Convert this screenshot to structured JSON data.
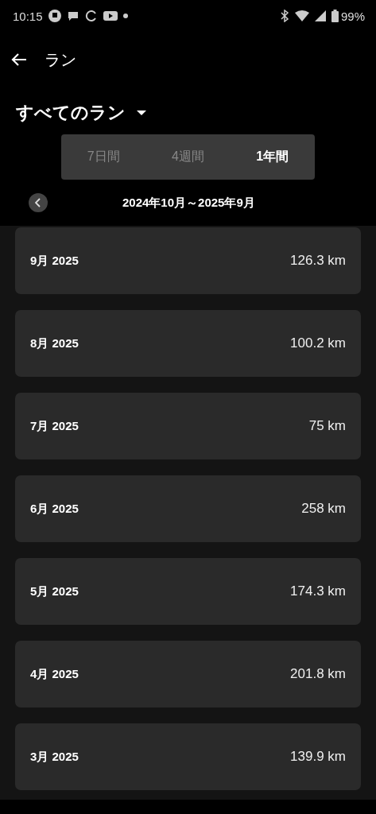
{
  "status_bar": {
    "time": "10:15",
    "battery": "99%"
  },
  "app_bar": {
    "title": "ラン"
  },
  "filter": {
    "label": "すべてのラン"
  },
  "tabs": [
    {
      "label": "7日間",
      "selected": false
    },
    {
      "label": "4週間",
      "selected": false
    },
    {
      "label": "1年間",
      "selected": true
    }
  ],
  "period": {
    "label": "2024年10月～2025年9月"
  },
  "months": [
    {
      "month": "9月 2025",
      "distance": "126.3 km"
    },
    {
      "month": "8月 2025",
      "distance": "100.2 km"
    },
    {
      "month": "7月 2025",
      "distance": "75 km"
    },
    {
      "month": "6月 2025",
      "distance": "258 km"
    },
    {
      "month": "5月 2025",
      "distance": "174.3 km"
    },
    {
      "month": "4月 2025",
      "distance": "201.8 km"
    },
    {
      "month": "3月 2025",
      "distance": "139.9 km"
    }
  ]
}
